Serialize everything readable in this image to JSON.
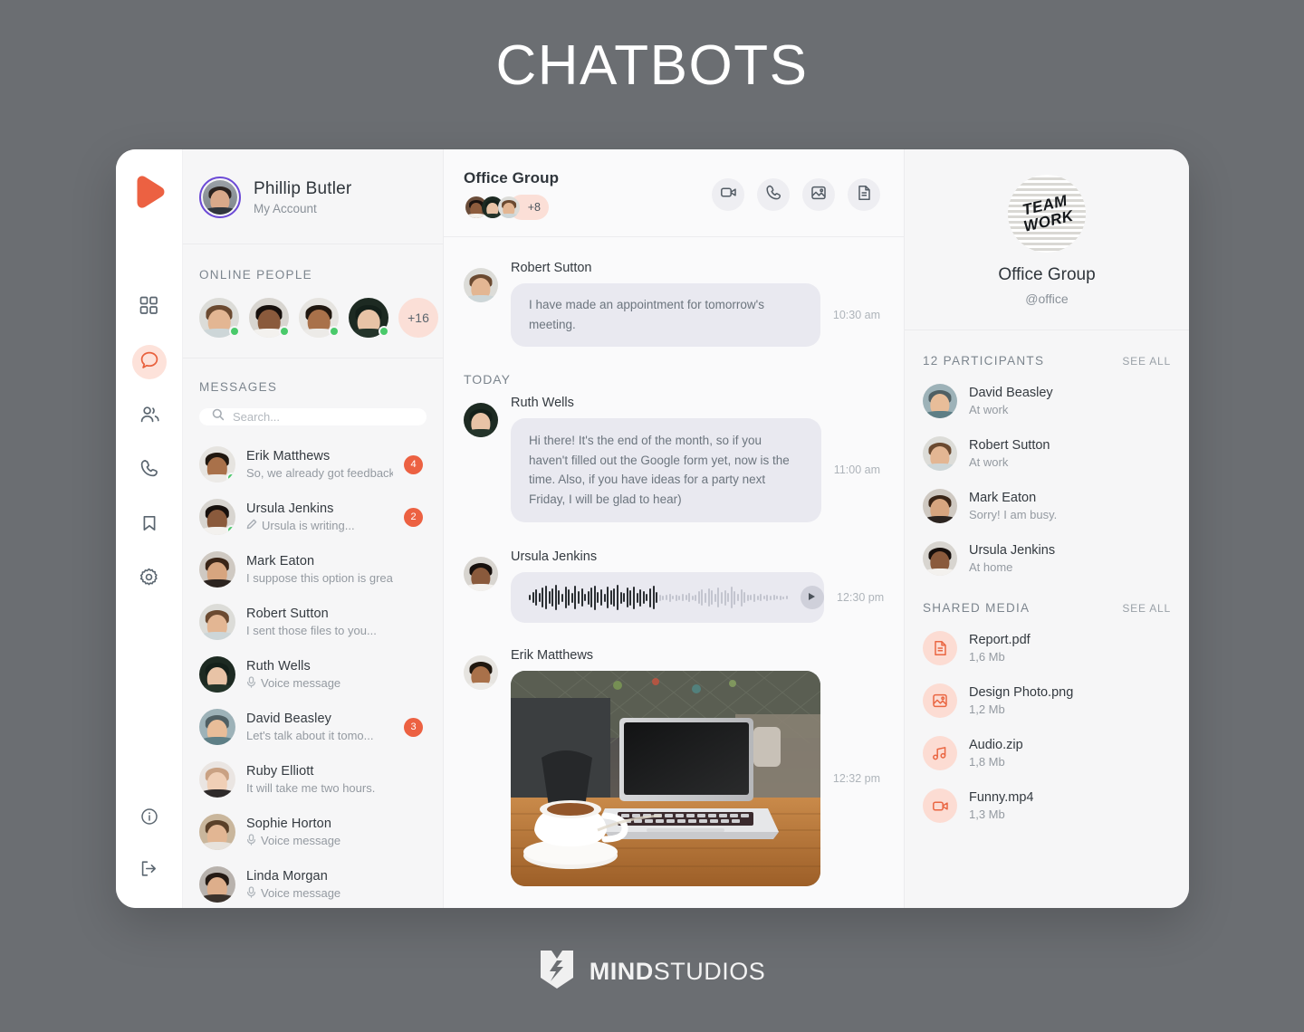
{
  "page": {
    "title": "CHATBOTS",
    "footer_brand_bold": "MIND",
    "footer_brand_light": "STUDIOS"
  },
  "colors": {
    "page_background": "#6b6e72",
    "accent": "#ec6142",
    "accent_soft": "#fbdfd7",
    "bubble": "#e9e9f0",
    "panel": "#f6f6f7",
    "chat_bg": "#fafafb",
    "online_dot": "#49c96a",
    "account_ring": "#6c4ad6"
  },
  "rail": {
    "logo_icon": "play-logo-icon",
    "items": [
      {
        "icon": "grid-icon",
        "name": "dashboard",
        "active": false
      },
      {
        "icon": "chat-bubble-icon",
        "name": "chats",
        "active": true
      },
      {
        "icon": "contacts-icon",
        "name": "contacts",
        "active": false
      },
      {
        "icon": "phone-icon",
        "name": "calls",
        "active": false
      },
      {
        "icon": "bookmark-icon",
        "name": "saved",
        "active": false
      },
      {
        "icon": "gear-icon",
        "name": "settings",
        "active": false
      }
    ],
    "bottom_items": [
      {
        "icon": "info-icon",
        "name": "info"
      },
      {
        "icon": "logout-icon",
        "name": "logout"
      }
    ]
  },
  "account": {
    "name": "Phillip Butler",
    "subtitle": "My Account",
    "avatar_icon": "user-avatar"
  },
  "online": {
    "heading": "ONLINE PEOPLE",
    "people": [
      {
        "name": "Robert Sutton",
        "online": true
      },
      {
        "name": "Ursula Jenkins",
        "online": true
      },
      {
        "name": "Erik Matthews",
        "online": true
      },
      {
        "name": "Ruth Wells",
        "online": true
      }
    ],
    "more_label": "+16"
  },
  "messages_panel": {
    "heading": "MESSAGES",
    "search": {
      "placeholder": "Search...",
      "value": "",
      "icon": "search-icon"
    },
    "conversations": [
      {
        "name": "Erik Matthews",
        "preview": "So, we already got feedback",
        "badge": "4",
        "online": true,
        "icon": ""
      },
      {
        "name": "Ursula Jenkins",
        "preview": "Ursula is writing...",
        "badge": "2",
        "online": true,
        "icon": "pencil-icon"
      },
      {
        "name": "Mark Eaton",
        "preview": "I suppose this option is grea",
        "badge": "",
        "online": false,
        "icon": ""
      },
      {
        "name": "Robert Sutton",
        "preview": "I sent those files to you...",
        "badge": "",
        "online": false,
        "icon": ""
      },
      {
        "name": "Ruth Wells",
        "preview": "Voice message",
        "badge": "",
        "online": false,
        "icon": "mic-icon"
      },
      {
        "name": "David Beasley",
        "preview": "Let's talk about it tomo...",
        "badge": "3",
        "online": false,
        "icon": ""
      },
      {
        "name": "Ruby Elliott",
        "preview": "It will take me two hours.",
        "badge": "",
        "online": false,
        "icon": ""
      },
      {
        "name": "Sophie Horton",
        "preview": "Voice message",
        "badge": "",
        "online": false,
        "icon": "mic-icon"
      },
      {
        "name": "Linda Morgan",
        "preview": "Voice message",
        "badge": "",
        "online": false,
        "icon": "mic-icon"
      }
    ]
  },
  "chat": {
    "title": "Office Group",
    "member_more_label": "+8",
    "actions": [
      {
        "icon": "video-camera-icon",
        "name": "video-call"
      },
      {
        "icon": "phone-icon",
        "name": "voice-call"
      },
      {
        "icon": "image-icon",
        "name": "gallery"
      },
      {
        "icon": "document-icon",
        "name": "files"
      }
    ],
    "day_divider": "TODAY",
    "messages": [
      {
        "type": "text",
        "sender": "Robert Sutton",
        "text": "I have made an appointment for tomorrow's meeting.",
        "time": "10:30 am"
      },
      {
        "type": "text",
        "sender": "Ruth Wells",
        "text": "Hi there! It's the end of the month, so if you haven't filled out the Google form yet, now is the time. Also, if you have ideas for a party next Friday, I will be glad to hear)",
        "time": "11:00 am"
      },
      {
        "type": "voice",
        "sender": "Ursula Jenkins",
        "text": "",
        "time": "12:30 pm",
        "play_icon": "play-icon"
      },
      {
        "type": "image",
        "sender": "Erik Matthews",
        "text": "",
        "time": "12:32 pm",
        "image_description": "laptop and coffee cup on wooden table"
      }
    ]
  },
  "group_info": {
    "avatar_line1": "TEAM",
    "avatar_line2": "WORK",
    "name": "Office Group",
    "handle": "@office",
    "participants_heading": "12 PARTICIPANTS",
    "participants_see_all": "SEE ALL",
    "participants": [
      {
        "name": "David Beasley",
        "status": "At work"
      },
      {
        "name": "Robert Sutton",
        "status": "At work"
      },
      {
        "name": "Mark Eaton",
        "status": "Sorry! I am busy."
      },
      {
        "name": "Ursula Jenkins",
        "status": "At home"
      }
    ],
    "media_heading": "SHARED MEDIA",
    "media_see_all": "SEE ALL",
    "media": [
      {
        "name": "Report.pdf",
        "size": "1,6 Mb",
        "icon": "document-icon"
      },
      {
        "name": "Design Photo.png",
        "size": "1,2 Mb",
        "icon": "image-icon"
      },
      {
        "name": "Audio.zip",
        "size": "1,8 Mb",
        "icon": "music-icon"
      },
      {
        "name": "Funny.mp4",
        "size": "1,3 Mb",
        "icon": "video-camera-icon"
      }
    ]
  }
}
